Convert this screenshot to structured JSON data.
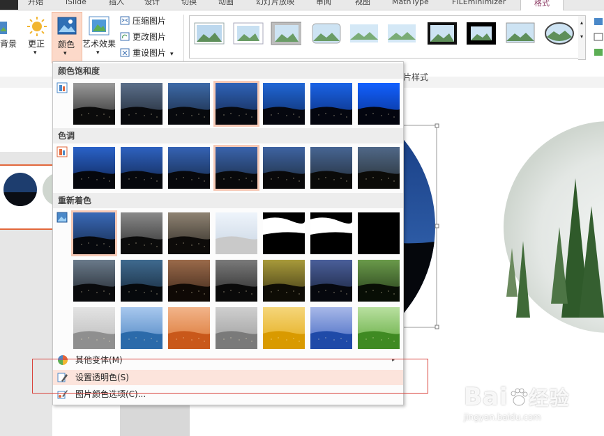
{
  "tabs": [
    "开始",
    "iSlide",
    "插入",
    "设计",
    "切换",
    "动画",
    "幻灯片放映",
    "审阅",
    "视图",
    "MathType",
    "FILEminimizer",
    "格式"
  ],
  "ribbon": {
    "bg_label": "背景",
    "corrections_label": "更正",
    "color_label": "颜色",
    "artistic_label": "艺术效果",
    "compress_label": "压缩图片",
    "change_label": "更改图片",
    "reset_label": "重设图片",
    "group_label": "图片样式"
  },
  "menu": {
    "saturation_header": "颜色饱和度",
    "tone_header": "色调",
    "recolor_header": "重新着色",
    "more_variations": "其他变体(M)",
    "set_transparent": "设置透明色(S)",
    "color_options": "图片颜色选项(C)..."
  },
  "watermark": {
    "brand": "Bai",
    "brand_cn": "经验",
    "url": "jingyan.baidu.com"
  },
  "colors": {
    "accent": "#e2673b",
    "tab_active": "#8b3a62",
    "highlight": "#fce4dc",
    "annotation": "#d9423b"
  }
}
